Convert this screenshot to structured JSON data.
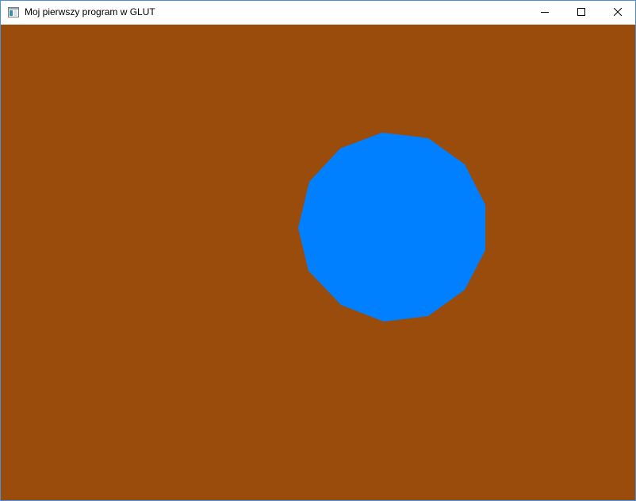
{
  "window": {
    "title": "Moj pierwszy program w GLUT"
  },
  "titlebar": {
    "app_icon": "window-app-icon",
    "buttons": [
      {
        "name": "minimize",
        "icon": "minimize-icon"
      },
      {
        "name": "maximize",
        "icon": "maximize-icon"
      },
      {
        "name": "close",
        "icon": "close-icon"
      }
    ]
  },
  "canvas": {
    "background_color": "#9a4c0d",
    "shape": {
      "type": "polygon",
      "sides": 13,
      "fill_color": "#0080ff"
    }
  }
}
